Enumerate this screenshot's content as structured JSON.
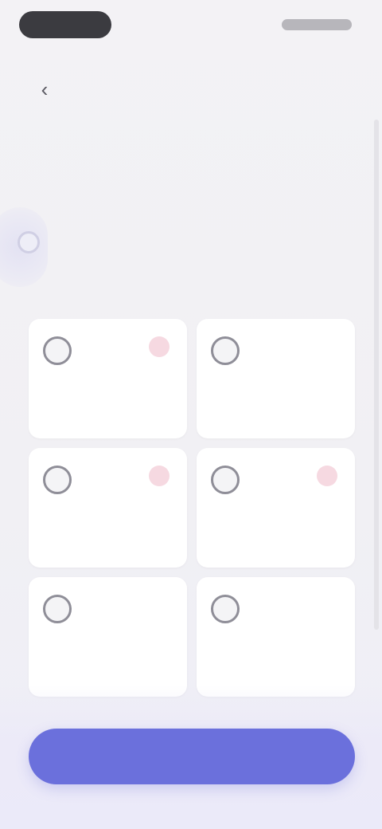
{
  "header": {
    "back_icon": "chevron-left-icon",
    "back_glyph": "‹"
  },
  "intro": {
    "title": "",
    "subtitle": ""
  },
  "tiles": [
    {
      "icon": "person-icon",
      "glyph": "",
      "label": "",
      "has_badge": true
    },
    {
      "icon": "bag-icon",
      "glyph": "",
      "label": "",
      "has_badge": false
    },
    {
      "icon": "person-icon",
      "glyph": "",
      "label": "",
      "has_badge": true
    },
    {
      "icon": "person-icon",
      "glyph": "",
      "label": "",
      "has_badge": true
    },
    {
      "icon": "mail-icon",
      "glyph": "",
      "label": "",
      "has_badge": false
    },
    {
      "icon": "globe-icon",
      "glyph": "",
      "label": "",
      "has_badge": false
    }
  ],
  "footer": {
    "continue_label": ""
  },
  "colors": {
    "accent": "#6b70dc",
    "badge": "#f6d9e1",
    "background": "#f2f1f4"
  }
}
